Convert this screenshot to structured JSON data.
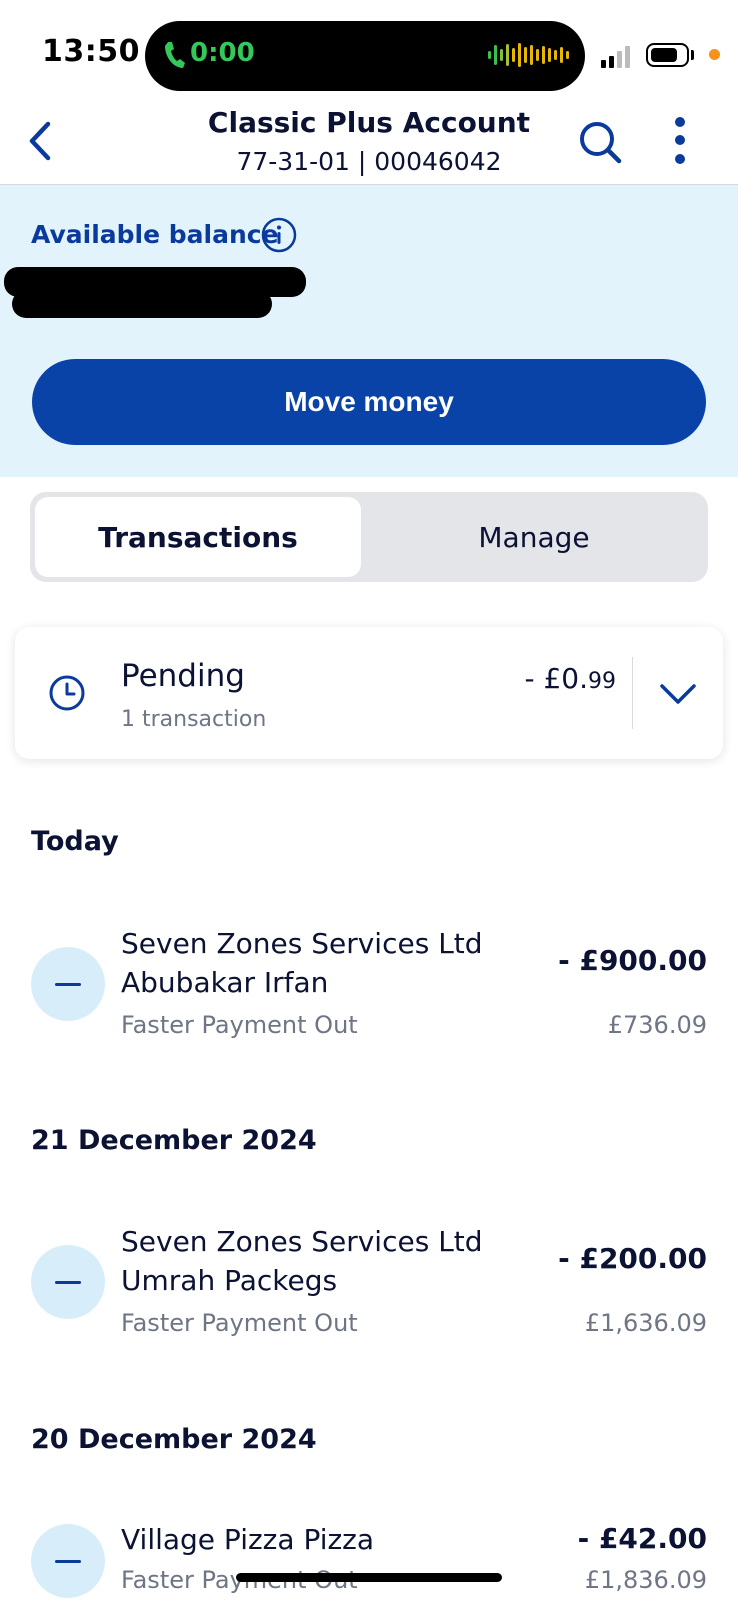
{
  "status_bar": {
    "time": "13:50",
    "call_timer": "0:00",
    "icons": [
      "phone-icon",
      "audio-wave-icon",
      "signal-icon",
      "battery-icon",
      "mic-indicator-icon"
    ]
  },
  "header": {
    "title": "Classic Plus Account",
    "account_details": "77-31-01 | 00046042",
    "icons": [
      "back-chevron-icon",
      "search-icon",
      "more-vertical-icon"
    ]
  },
  "balance": {
    "label": "Available balance",
    "info_icon": "info-icon",
    "value_redacted": true
  },
  "actions": {
    "move_money": "Move money"
  },
  "tabs": [
    {
      "label": "Transactions",
      "active": true
    },
    {
      "label": "Manage",
      "active": false
    }
  ],
  "pending": {
    "title": "Pending",
    "count_text": "1 transaction",
    "amount_main": "- £0.",
    "amount_pence": "99",
    "icon": "clock-icon",
    "expand_icon": "chevron-down-icon"
  },
  "groups": [
    {
      "date": "Today",
      "transactions": [
        {
          "line1": "Seven Zones Services Ltd",
          "line2": "Abubakar Irfan",
          "type": "Faster Payment Out",
          "amount": "- £900.00",
          "balance": "£736.09"
        }
      ]
    },
    {
      "date": "21 December 2024",
      "transactions": [
        {
          "line1": "Seven Zones Services Ltd",
          "line2": "Umrah Packegs",
          "type": "Faster Payment Out",
          "amount": "- £200.00",
          "balance": "£1,636.09"
        }
      ]
    },
    {
      "date": "20 December 2024",
      "transactions": [
        {
          "line1": "Village Pizza Pizza",
          "type": "Faster Payment Out",
          "amount": "- £42.00",
          "balance": "£1,836.09"
        }
      ]
    }
  ],
  "colors": {
    "brand_blue": "#0a43a8",
    "panel_bg": "#e2f3fb",
    "text_dark": "#0b1233",
    "text_muted": "#6e7585"
  }
}
